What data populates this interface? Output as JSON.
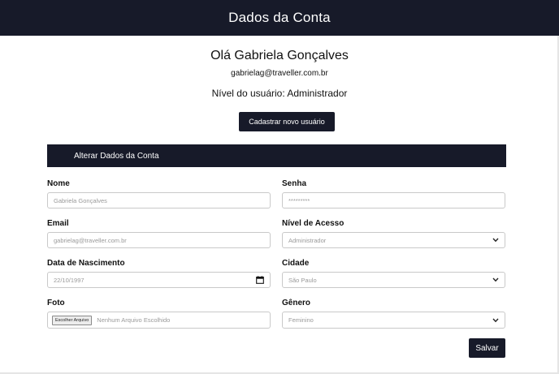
{
  "header": {
    "title": "Dados da Conta"
  },
  "profile": {
    "greeting": "Olá Gabriela Gonçalves",
    "email": "gabrielag@traveller.com.br",
    "level": "Nível do usuário: Administrador",
    "register_button": "Cadastrar novo usuário"
  },
  "section": {
    "title": "Alterar Dados da Conta"
  },
  "form": {
    "nome": {
      "label": "Nome",
      "placeholder": "Gabriela Gonçalves"
    },
    "senha": {
      "label": "Senha",
      "placeholder": "*********"
    },
    "email": {
      "label": "Email",
      "placeholder": "gabrielag@traveller.com.br"
    },
    "nivel": {
      "label": "Nível de Acesso",
      "value": "Administrador"
    },
    "nascimento": {
      "label": "Data de Nascimento",
      "value": "22/10/1997"
    },
    "cidade": {
      "label": "Cidade",
      "value": "São Paulo"
    },
    "foto": {
      "label": "Foto",
      "button": "Escolher Arquivo",
      "status": "Nenhum Arquivo Escolhido"
    },
    "genero": {
      "label": "Gênero",
      "value": "Feminino"
    },
    "save_button": "Salvar"
  },
  "icons": {
    "select": "chevron-down-icon",
    "date": "calendar-icon"
  },
  "colors": {
    "primary": "#171a29",
    "border": "#c9c9c9",
    "placeholder": "#9a9a9a"
  }
}
